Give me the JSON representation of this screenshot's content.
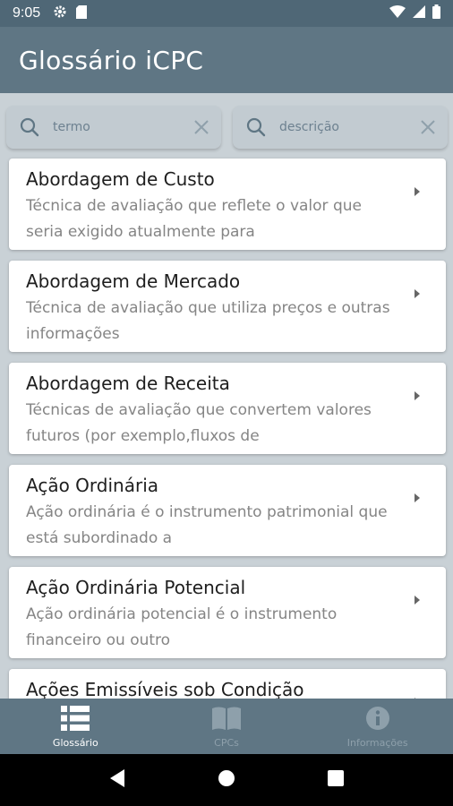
{
  "status_bar": {
    "time": "9:05",
    "icons": [
      "gear-icon",
      "sd-card-icon",
      "wifi-icon",
      "signal-icon",
      "battery-icon"
    ]
  },
  "app_bar": {
    "title": "Glossário iCPC"
  },
  "search": {
    "term_placeholder": "termo",
    "desc_placeholder": "descrição"
  },
  "list": {
    "items": [
      {
        "title": "Abordagem de Custo",
        "description": "Técnica de avaliação que reflete o valor que seria exigido atualmente para"
      },
      {
        "title": "Abordagem de Mercado",
        "description": "Técnica de avaliação que utiliza preços e outras informações"
      },
      {
        "title": "Abordagem de Receita",
        "description": "Técnicas de avaliação que convertem valores futuros (por exemplo,fluxos de"
      },
      {
        "title": "Ação Ordinária",
        "description": "Ação ordinária é o instrumento patrimonial que está subordinado a"
      },
      {
        "title": "Ação Ordinária Potencial",
        "description": "Ação ordinária potencial é o instrumento financeiro ou outro"
      },
      {
        "title": "Ações Emissíveis sob Condição",
        "description": ""
      }
    ]
  },
  "bottom_nav": {
    "items": [
      {
        "label": "Glossário",
        "icon": "list-icon",
        "active": true
      },
      {
        "label": "CPCs",
        "icon": "book-icon",
        "active": false
      },
      {
        "label": "Informações",
        "icon": "info-icon",
        "active": false
      }
    ]
  },
  "colors": {
    "status_bar": "#4f6776",
    "app_bar": "#5f7684",
    "background": "#c9d1d6",
    "search_box": "#c2cbd1",
    "card": "#ffffff"
  }
}
